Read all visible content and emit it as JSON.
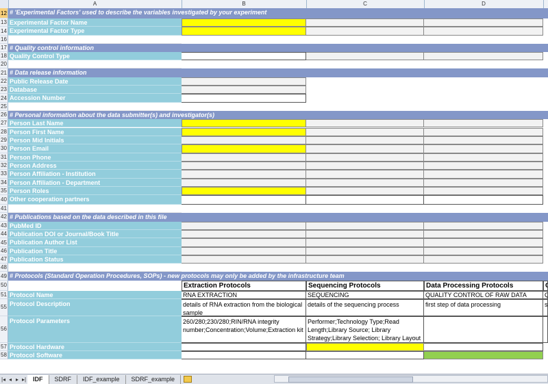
{
  "columns": [
    "A",
    "B",
    "C",
    "D"
  ],
  "rows": [
    {
      "n": "12",
      "type": "section",
      "text": "# 'Experimental Factors' used to describe the variables investigated by your experiment",
      "selected": true
    },
    {
      "n": "13",
      "type": "field",
      "text": "Experimental Factor Name",
      "b": "yellow",
      "c": "gray",
      "d": "gray"
    },
    {
      "n": "14",
      "type": "field",
      "text": "Experimental Factor Type",
      "b": "yellow",
      "c": "gray",
      "d": "gray"
    },
    {
      "n": "16",
      "type": "blank"
    },
    {
      "n": "17",
      "type": "section",
      "text": "# Quality control information"
    },
    {
      "n": "18",
      "type": "field",
      "text": "Quality Control Type",
      "b": "white",
      "c": "gray",
      "d": "gray"
    },
    {
      "n": "20",
      "type": "blank"
    },
    {
      "n": "21",
      "type": "section",
      "text": "# Data release information"
    },
    {
      "n": "22",
      "type": "field",
      "text": "Public Release Date",
      "b": "gray"
    },
    {
      "n": "23",
      "type": "field",
      "text": "Database",
      "b": "gray"
    },
    {
      "n": "24",
      "type": "field",
      "text": "Accession Number",
      "b": "white"
    },
    {
      "n": "25",
      "type": "blank"
    },
    {
      "n": "26",
      "type": "section",
      "text": "# Personal information about the data submitter(s) and investigator(s)"
    },
    {
      "n": "27",
      "type": "field",
      "text": "Person Last Name",
      "b": "yellow",
      "c": "gray",
      "d": "gray"
    },
    {
      "n": "28",
      "type": "field",
      "text": "Person First Name",
      "b": "yellow",
      "c": "gray",
      "d": "gray"
    },
    {
      "n": "29",
      "type": "field",
      "text": "Person Mid Initials",
      "b": "gray",
      "c": "gray",
      "d": "gray"
    },
    {
      "n": "30",
      "type": "field",
      "text": "Person Email",
      "b": "yellow",
      "c": "gray",
      "d": "gray"
    },
    {
      "n": "31",
      "type": "field",
      "text": "Person Phone",
      "b": "gray",
      "c": "gray",
      "d": "gray"
    },
    {
      "n": "32",
      "type": "field",
      "text": "Person Address",
      "b": "gray",
      "c": "gray",
      "d": "gray"
    },
    {
      "n": "33",
      "type": "field",
      "text": "Person Affiliation - Institution",
      "b": "gray",
      "c": "gray",
      "d": "gray"
    },
    {
      "n": "34",
      "type": "field",
      "text": "Person Affiliation - Department",
      "b": "gray",
      "c": "gray",
      "d": "gray"
    },
    {
      "n": "35",
      "type": "field",
      "text": "Person Roles",
      "b": "yellow",
      "c": "gray",
      "d": "gray"
    },
    {
      "n": "40",
      "type": "field",
      "text": "Other cooperation partners",
      "b": "white",
      "c": "white",
      "d": "white"
    },
    {
      "n": "41",
      "type": "blank"
    },
    {
      "n": "42",
      "type": "section",
      "text": "# Publications based on the data described in this file"
    },
    {
      "n": "43",
      "type": "field",
      "text": "PubMed ID",
      "b": "gray",
      "c": "gray",
      "d": "gray"
    },
    {
      "n": "44",
      "type": "field",
      "text": "Publication DOI or Journal/Book Title",
      "b": "gray",
      "c": "gray",
      "d": "gray"
    },
    {
      "n": "45",
      "type": "field",
      "text": "Publication Author List",
      "b": "gray",
      "c": "gray",
      "d": "gray"
    },
    {
      "n": "46",
      "type": "field",
      "text": "Publication Title",
      "b": "gray",
      "c": "gray",
      "d": "gray"
    },
    {
      "n": "47",
      "type": "field",
      "text": "Publication Status",
      "b": "gray",
      "c": "gray",
      "d": "gray"
    },
    {
      "n": "48",
      "type": "blank"
    },
    {
      "n": "49",
      "type": "section",
      "text": "# Protocols (Standard Operation Procedures, SOPs)  - new protocols may only be added by the infrastructure team"
    }
  ],
  "protocols": {
    "header_row": "50",
    "headers": [
      "Extraction Protocols",
      "Sequencing Protocols",
      "Data Processing Protocols",
      "Q"
    ],
    "name_row": {
      "n": "51",
      "label": "Protocol Name",
      "values": [
        "RNA EXTRACTION",
        "SEQUENCING",
        "QUALITY CONTROL OF RAW DATA",
        "Q"
      ]
    },
    "desc_row": {
      "n": "55",
      "label": "Protocol Description",
      "values": [
        "details of RNA extraction from the biological sample",
        "details of the sequencing process",
        "first step of data processing",
        "se"
      ]
    },
    "param_row": {
      "n": "56",
      "label": "Protocol Parameters",
      "values": [
        "260/280;230/280;RIN/RNA integrity number;Concentration;Volume;Extraction kit",
        "Performer;Technology Type;Read Length;Library Source; Library Strategy;Library Selection; Library Layout",
        "",
        ""
      ]
    },
    "hw_row": {
      "n": "57",
      "label": "Protocol Hardware"
    },
    "sw_row": {
      "n": "58",
      "label": "Protocol Software"
    }
  },
  "sheet_tabs": [
    "IDF",
    "SDRF",
    "IDF_example",
    "SDRF_example"
  ],
  "active_tab": "IDF",
  "nav_glyphs": [
    "|◂",
    "◂",
    "▸",
    "▸|"
  ]
}
